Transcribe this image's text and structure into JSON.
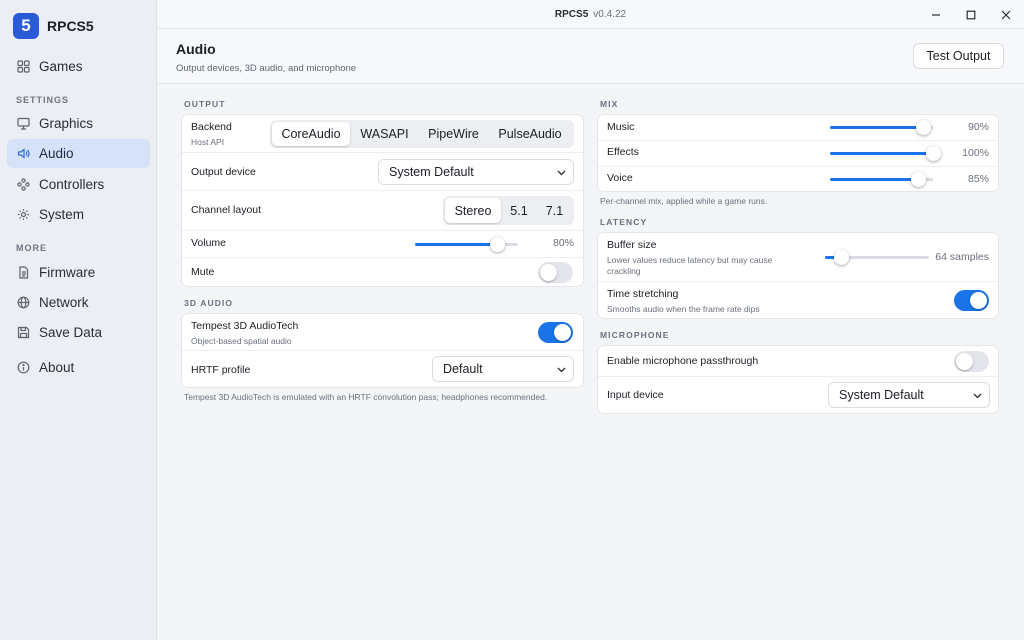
{
  "app": {
    "name": "RPCS5",
    "logo_glyph": "5",
    "window_title": "RPCS5",
    "version": "v0.4.22",
    "accent": "#1a73e8"
  },
  "sidebar": {
    "items": [
      {
        "label": "Games",
        "icon": "grid-icon"
      },
      {
        "label": "Graphics",
        "icon": "monitor-icon"
      },
      {
        "label": "Audio",
        "icon": "speaker-icon",
        "active": true
      },
      {
        "label": "Controllers",
        "icon": "gamepad-icon"
      },
      {
        "label": "System",
        "icon": "gear-icon"
      },
      {
        "label": "Firmware",
        "icon": "document-icon"
      },
      {
        "label": "Network",
        "icon": "globe-icon"
      },
      {
        "label": "Save Data",
        "icon": "floppy-icon"
      },
      {
        "label": "About",
        "icon": "info-icon"
      }
    ],
    "section_settings": "SETTINGS",
    "section_more": "MORE"
  },
  "header": {
    "title": "Audio",
    "subtitle": "Output devices, 3D audio, and microphone",
    "test_button": "Test Output"
  },
  "output": {
    "section": "OUTPUT",
    "backend_label": "Backend",
    "backend_sub": "Host API",
    "backend_options": [
      "CoreAudio",
      "WASAPI",
      "PipeWire",
      "PulseAudio"
    ],
    "backend_selected": "CoreAudio",
    "device_label": "Output device",
    "device_value": "System Default",
    "channel_label": "Channel layout",
    "channel_options": [
      "Stereo",
      "5.1",
      "7.1"
    ],
    "channel_selected": "Stereo",
    "volume_label": "Volume",
    "volume_value": 80,
    "volume_text": "80%",
    "mute_label": "Mute",
    "mute_on": false
  },
  "audio3d": {
    "section": "3D AUDIO",
    "tempest_label": "Tempest 3D AudioTech",
    "tempest_sub": "Object-based spatial audio",
    "tempest_on": true,
    "hrtf_label": "HRTF profile",
    "hrtf_value": "Default",
    "note": "Tempest 3D AudioTech is emulated with an HRTF convolution pass; headphones recommended."
  },
  "mix": {
    "section": "MIX",
    "channels": [
      {
        "label": "Music",
        "value": 90,
        "text": "90%"
      },
      {
        "label": "Effects",
        "value": 100,
        "text": "100%"
      },
      {
        "label": "Voice",
        "value": 85,
        "text": "85%"
      }
    ],
    "note": "Per-channel mix, applied while a game runs."
  },
  "latency": {
    "section": "LATENCY",
    "buffer_label": "Buffer size",
    "buffer_sub": "Lower values reduce latency but may cause crackling",
    "buffer_value": 64,
    "buffer_text": "64 samples",
    "buffer_fraction": 0.15,
    "stretch_label": "Time stretching",
    "stretch_sub": "Smooths audio when the frame rate dips",
    "stretch_on": true
  },
  "microphone": {
    "section": "MICROPHONE",
    "passthrough_label": "Enable microphone passthrough",
    "passthrough_on": false,
    "input_label": "Input device",
    "input_value": "System Default"
  }
}
